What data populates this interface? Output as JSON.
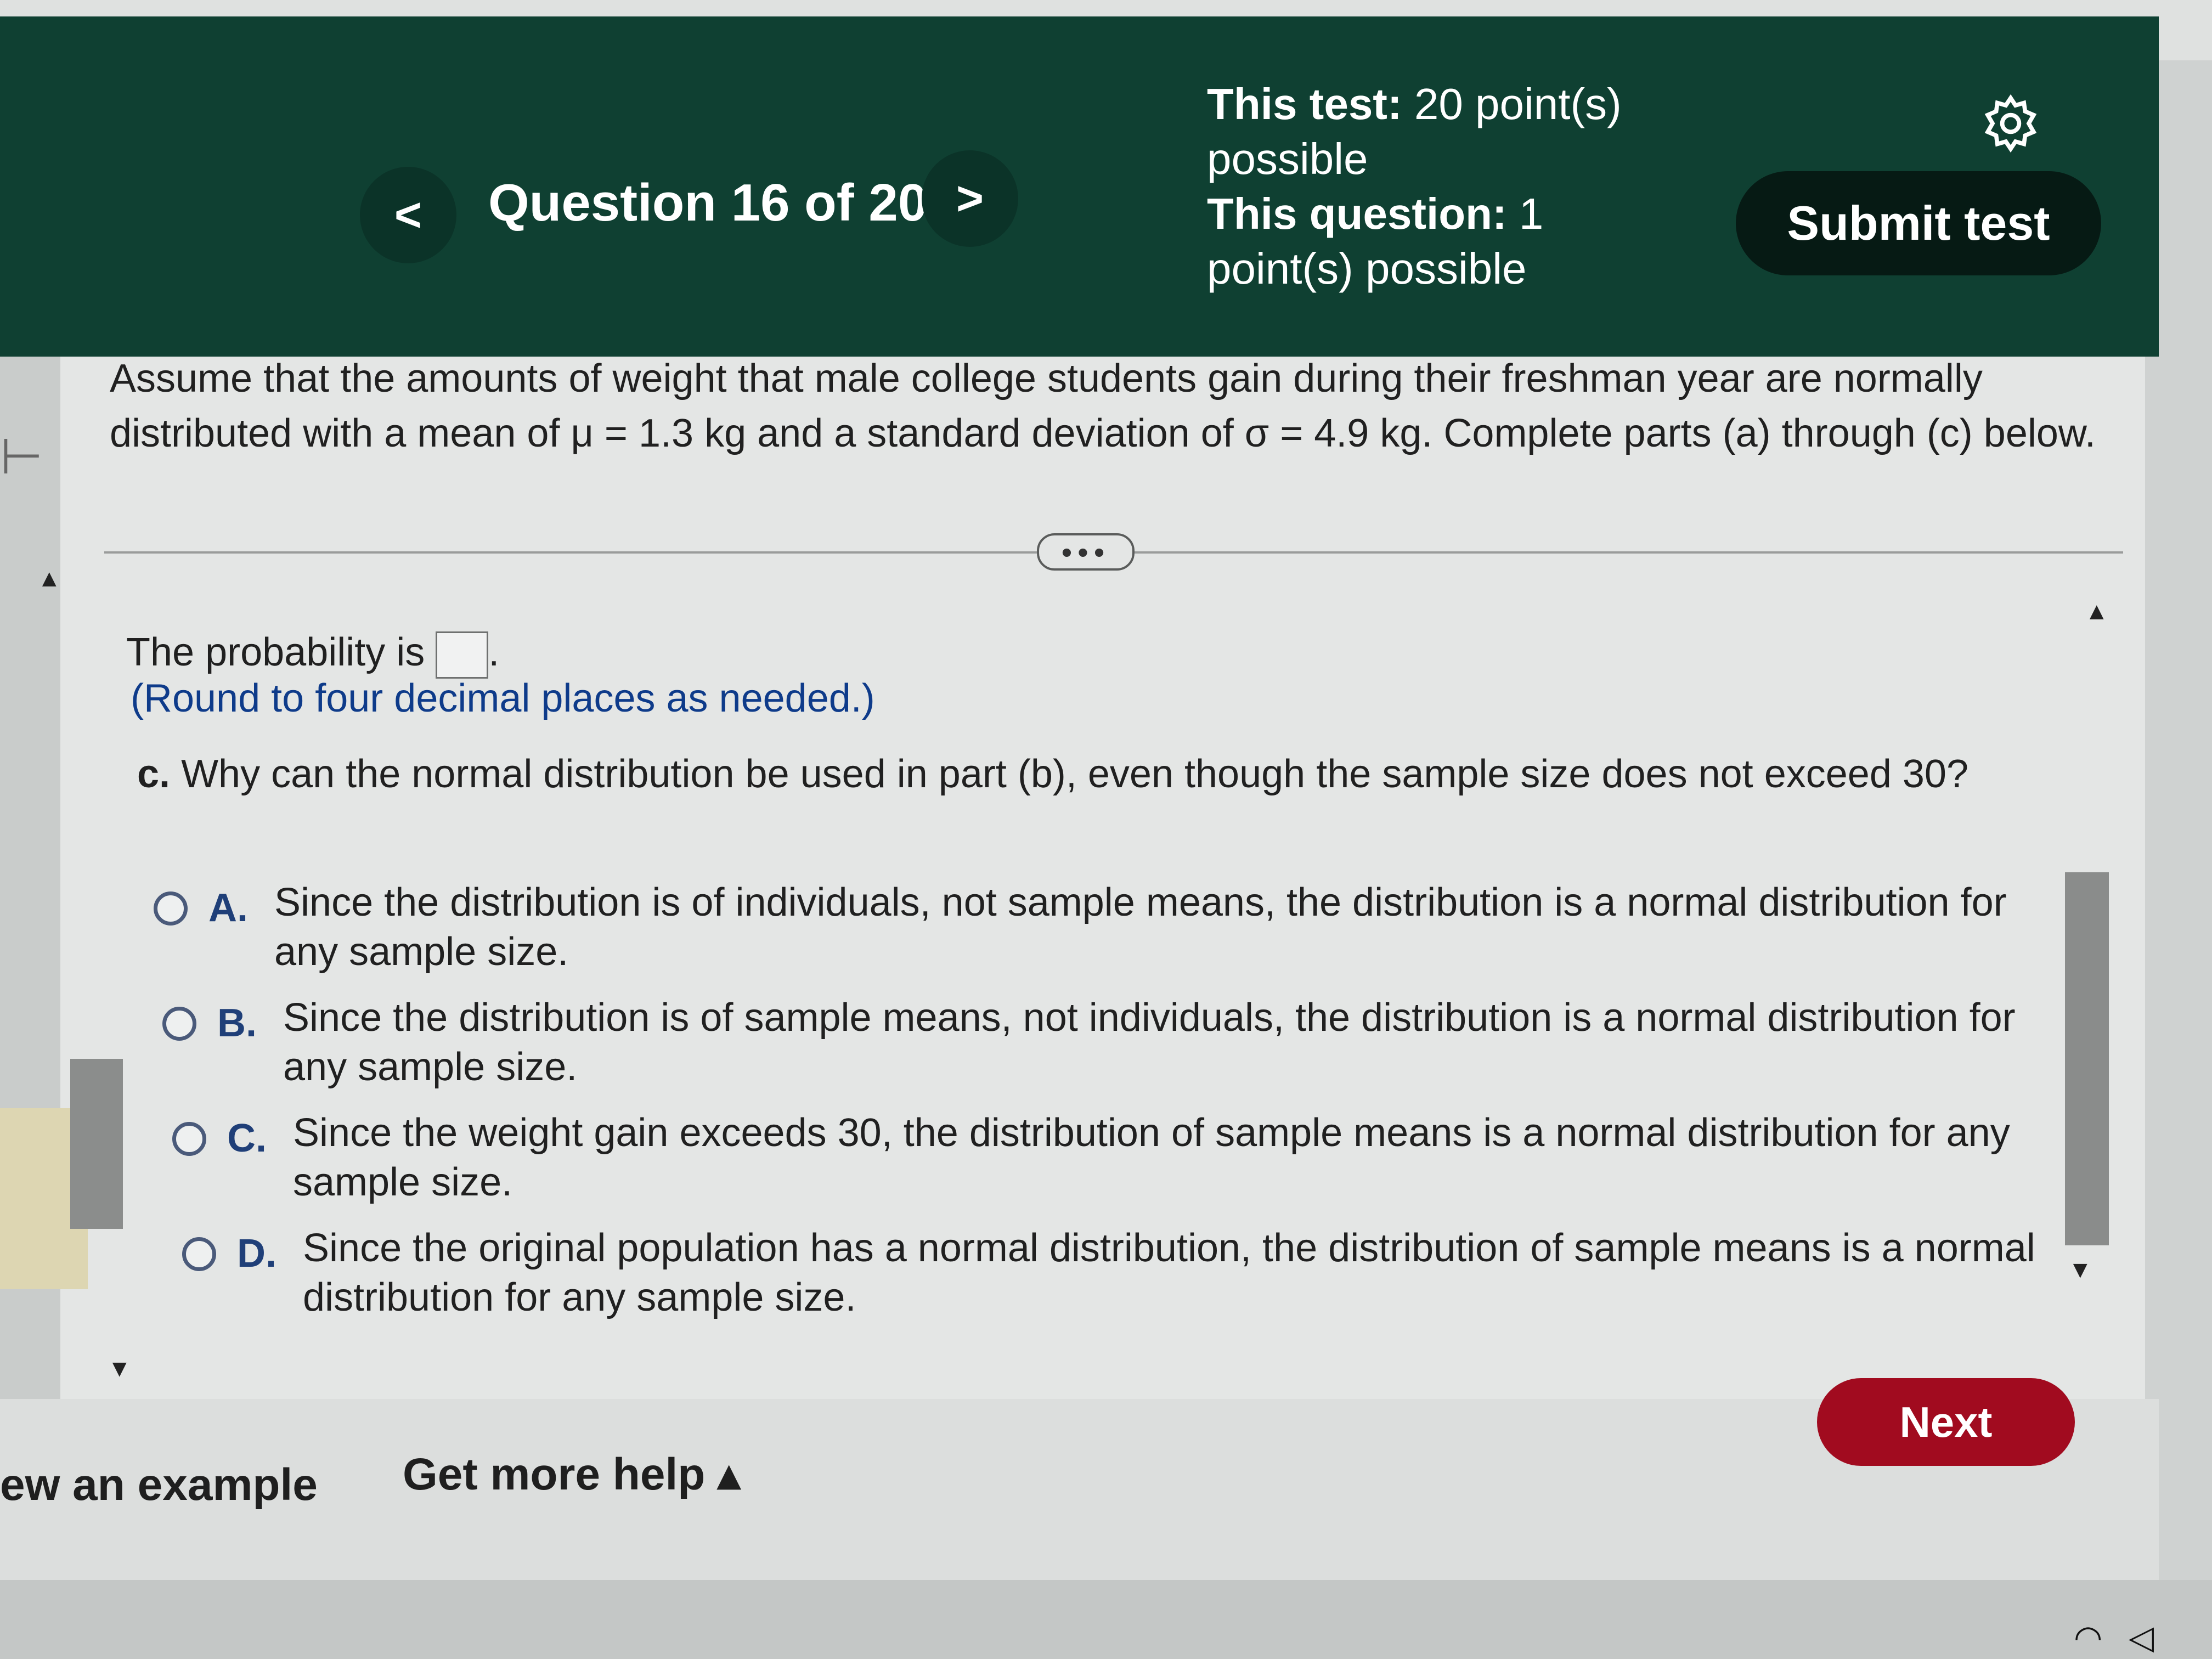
{
  "header": {
    "prev_label": "<",
    "question_title": "Question 16 of 20",
    "next_label": ">",
    "test_points_bold": "This test:",
    "test_points_value": "20 point(s)",
    "test_points_suffix": "possible",
    "question_points_bold": "This question:",
    "question_points_value": "1",
    "question_points_suffix": "point(s) possible",
    "settings_icon": "gear-icon",
    "submit_label": "Submit test"
  },
  "problem": {
    "text": "Assume that the amounts of weight that male college students gain during their freshman year are normally distributed with a mean of μ = 1.3 kg and a standard deviation of σ = 4.9 kg. Complete parts (a) through (c) below."
  },
  "expand_dots": "•••",
  "part_b": {
    "prob_prefix": "The probability is",
    "prob_suffix": ".",
    "answer_value": "",
    "round_note": "(Round to four decimal places as needed.)"
  },
  "part_c": {
    "label": "c.",
    "question": "Why can the normal distribution be used in part (b), even though the sample size does not exceed 30?",
    "options": [
      {
        "letter": "A.",
        "text": "Since the distribution is of individuals, not sample means, the distribution is a normal distribution for any sample size."
      },
      {
        "letter": "B.",
        "text": "Since the distribution is of sample means, not individuals, the distribution is a normal distribution for any sample size."
      },
      {
        "letter": "C.",
        "text": "Since the weight gain exceeds 30, the distribution of sample means is a normal distribution for any sample size."
      },
      {
        "letter": "D.",
        "text": "Since the original population has a normal distribution, the distribution of sample means is a normal distribution for any sample size."
      }
    ]
  },
  "footer": {
    "view_example": "ew an example",
    "get_more_help": "Get more help ▴",
    "next_label": "Next"
  },
  "colors": {
    "header_bg": "#0f4032",
    "submit_bg": "#061a14",
    "next_bg": "#a10b1f",
    "note_blue": "#0e3b8a"
  }
}
